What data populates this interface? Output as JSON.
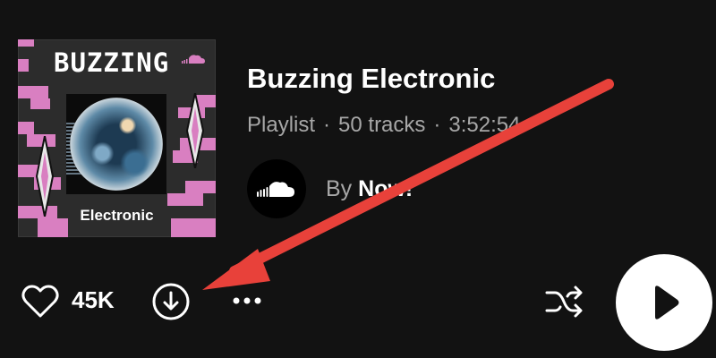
{
  "artwork": {
    "title": "BUZZING",
    "genre": "Electronic",
    "cloud_icon": "soundcloud-icon",
    "accent_color": "#d97fc1"
  },
  "playlist": {
    "title": "Buzzing Electronic",
    "type": "Playlist",
    "separator": "·",
    "tracks": "50 tracks",
    "duration": "3:52:54"
  },
  "author": {
    "prefix": "By",
    "name": "Now!",
    "avatar_icon": "soundcloud-logo-icon"
  },
  "controls": {
    "like_icon": "heart-icon",
    "like_count": "45K",
    "download_icon": "download-icon",
    "more_icon": "more-dots-icon",
    "shuffle_icon": "shuffle-icon",
    "play_icon": "play-icon"
  },
  "annotation": {
    "color": "#e8413a",
    "points_to": "download-button"
  }
}
